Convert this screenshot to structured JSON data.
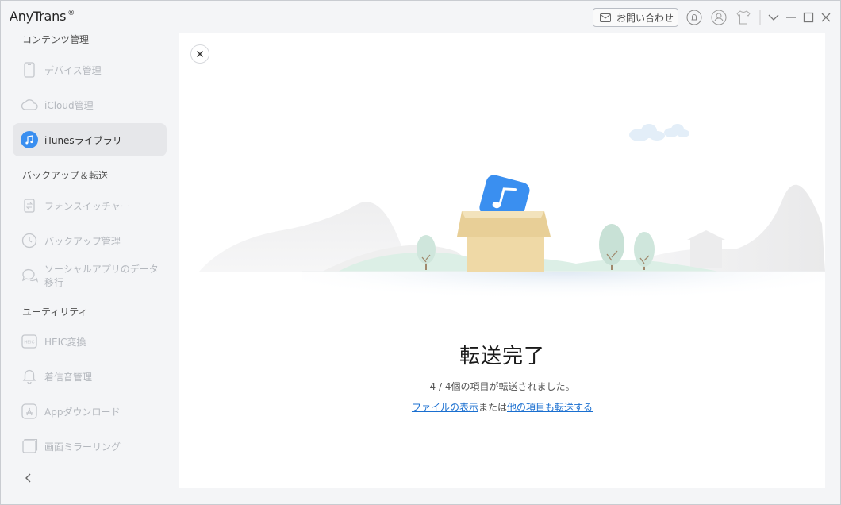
{
  "app": {
    "title": "AnyTrans",
    "trademark": "®"
  },
  "titlebar": {
    "contact_label": "お問い合わせ",
    "icons": [
      "mail-icon",
      "bell-icon",
      "user-icon",
      "shirt-icon",
      "chevron-down-icon",
      "minimize-icon",
      "maximize-icon",
      "close-icon"
    ]
  },
  "sidebar": {
    "sections": [
      {
        "title": "コンテンツ管理"
      },
      {
        "title": "バックアップ＆転送"
      },
      {
        "title": "ユーティリティ"
      }
    ],
    "items": [
      {
        "label": "デバイス管理",
        "icon": "phone-icon",
        "active": false
      },
      {
        "label": "iCloud管理",
        "icon": "cloud-icon",
        "active": false
      },
      {
        "label": "iTunesライブラリ",
        "icon": "music-note-icon",
        "active": true
      },
      {
        "label": "フォンスイッチャー",
        "icon": "phone-switch-icon",
        "active": false
      },
      {
        "label": "バックアップ管理",
        "icon": "clock-history-icon",
        "active": false
      },
      {
        "label": "ソーシャルアプリのデータ移行",
        "icon": "chat-bubbles-icon",
        "active": false
      },
      {
        "label": "HEIC変換",
        "icon": "heic-icon",
        "active": false
      },
      {
        "label": "着信音管理",
        "icon": "bell-icon",
        "active": false
      },
      {
        "label": "Appダウンロード",
        "icon": "app-store-icon",
        "active": false
      },
      {
        "label": "画面ミラーリング",
        "icon": "screen-mirror-icon",
        "active": false
      }
    ],
    "collapse_icon": "chevron-left-icon"
  },
  "main": {
    "close_icon": "close-icon",
    "title": "転送完了",
    "subtitle": "4 / 4個の項目が転送されました。",
    "links": {
      "show_files": "ファイルの表示",
      "or": "または",
      "transfer_more": "他の項目も転送する"
    }
  },
  "colors": {
    "accent": "#1a6fd0",
    "active_bg": "#e6e7ea",
    "music_blue": "#3a8ff0"
  }
}
